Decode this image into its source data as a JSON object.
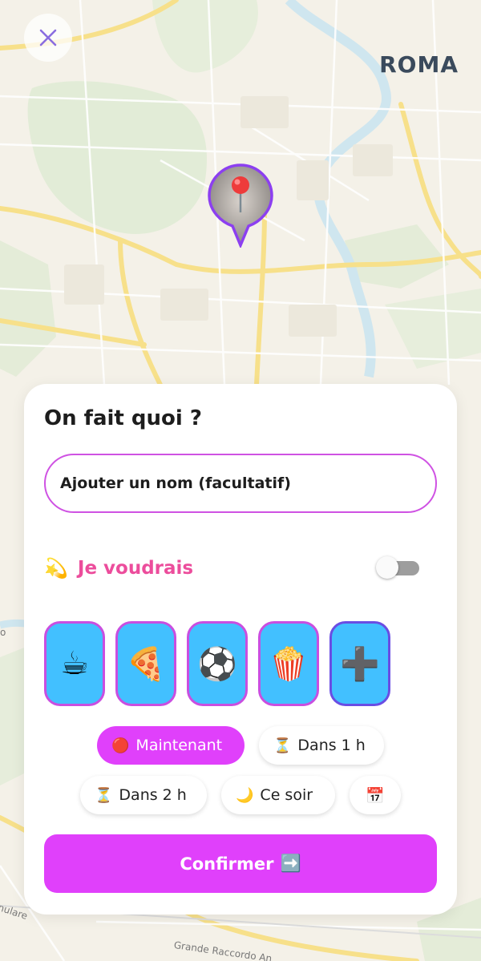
{
  "map": {
    "city_label": "ROMA",
    "road_labels": [
      "nulare",
      "Grande Raccordo An",
      "o"
    ]
  },
  "close": {
    "icon": "close-icon"
  },
  "pin": {
    "icon": "map-pin-icon"
  },
  "card": {
    "title": "On fait quoi ?",
    "name_input": {
      "placeholder": "Ajouter un nom (facultatif)",
      "value": ""
    },
    "wish": {
      "icon": "💫",
      "label": "Je voudrais",
      "toggle_on": false
    },
    "activities": [
      {
        "emoji": "☕",
        "name": "coffee"
      },
      {
        "emoji": "🍕",
        "name": "pizza"
      },
      {
        "emoji": "⚽",
        "name": "football"
      },
      {
        "emoji": "🍿",
        "name": "popcorn"
      },
      {
        "emoji": "➕",
        "name": "add"
      }
    ],
    "time_chips": {
      "now": {
        "emoji": "🔴",
        "label": "Maintenant",
        "active": true
      },
      "in1h": {
        "emoji": "⏳",
        "label": "Dans 1 h"
      },
      "in2h": {
        "emoji": "⏳",
        "label": "Dans 2 h"
      },
      "tonight": {
        "emoji": "🌙",
        "label": "Ce soir"
      },
      "calendar": {
        "emoji": "📅"
      }
    },
    "confirm": {
      "label": "Confirmer",
      "emoji": "➡️"
    }
  },
  "colors": {
    "accent": "#e040fb",
    "border": "#cf52e3",
    "tile": "#42c0ff",
    "wish_text": "#ec4d9c"
  }
}
